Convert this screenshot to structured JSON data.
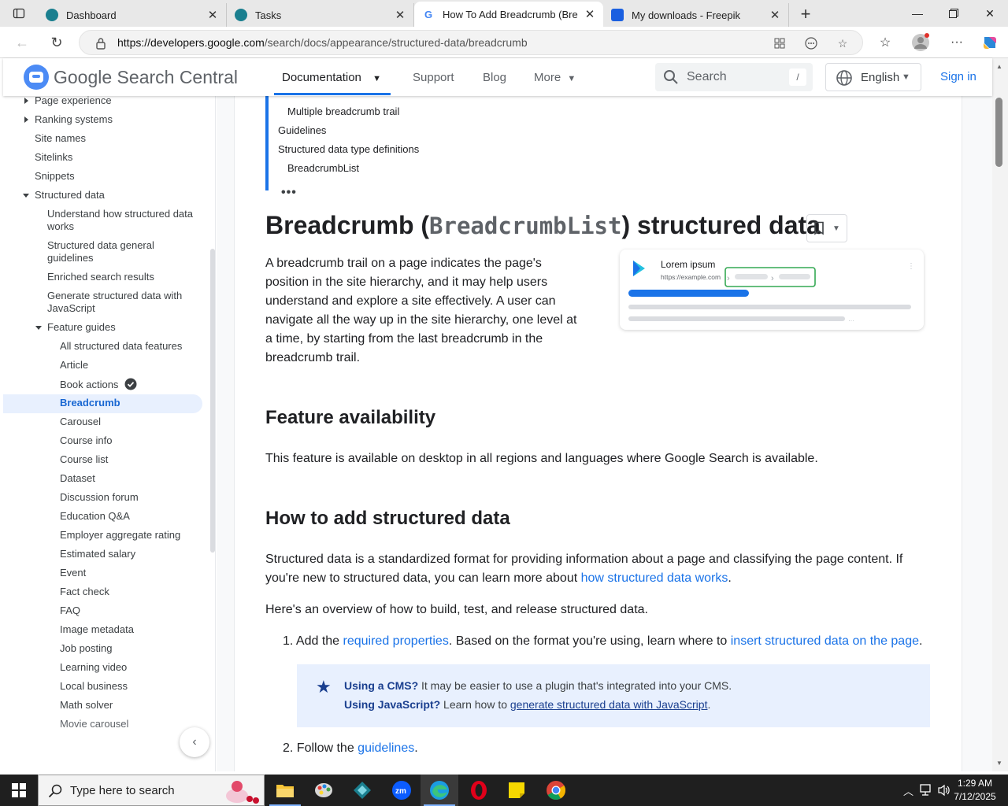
{
  "browser": {
    "tabs": [
      {
        "title": "Dashboard",
        "close": "✕",
        "favicon_color": "#1a7f8f"
      },
      {
        "title": "Tasks",
        "close": "✕",
        "favicon_color": "#1a7f8f"
      },
      {
        "title": "How To Add Breadcrumb (Breadc",
        "close": "✕",
        "favicon_color": "#4285f4"
      },
      {
        "title": "My downloads - Freepik",
        "close": "✕",
        "favicon_color": "#1a5fe0"
      }
    ],
    "url_domain": "https://developers.google.com",
    "url_path": "/search/docs/appearance/structured-data/breadcrumb"
  },
  "site": {
    "logo_google": "Google",
    "logo_product": " Search Central",
    "nav": {
      "documentation": "Documentation",
      "support": "Support",
      "blog": "Blog",
      "more": "More"
    },
    "search_placeholder": "Search",
    "search_shortcut": "/",
    "language": "English",
    "sign_in": "Sign in"
  },
  "leftnav": {
    "items": [
      {
        "label": "Page experience"
      },
      {
        "label": "Ranking systems"
      },
      {
        "label": "Site names"
      },
      {
        "label": "Sitelinks"
      },
      {
        "label": "Snippets"
      },
      {
        "label": "Structured data"
      },
      {
        "label": "Understand how structured data works"
      },
      {
        "label": "Structured data general guidelines"
      },
      {
        "label": "Enriched search results"
      },
      {
        "label": "Generate structured data with JavaScript"
      },
      {
        "label": "Feature guides"
      },
      {
        "label": "All structured data features"
      },
      {
        "label": "Article"
      },
      {
        "label": "Book actions"
      },
      {
        "label": "Breadcrumb"
      },
      {
        "label": "Carousel"
      },
      {
        "label": "Course info"
      },
      {
        "label": "Course list"
      },
      {
        "label": "Dataset"
      },
      {
        "label": "Discussion forum"
      },
      {
        "label": "Education Q&A"
      },
      {
        "label": "Employer aggregate rating"
      },
      {
        "label": "Estimated salary"
      },
      {
        "label": "Event"
      },
      {
        "label": "Fact check"
      },
      {
        "label": "FAQ"
      },
      {
        "label": "Image metadata"
      },
      {
        "label": "Job posting"
      },
      {
        "label": "Learning video"
      },
      {
        "label": "Local business"
      },
      {
        "label": "Math solver"
      },
      {
        "label": "Movie carousel"
      }
    ]
  },
  "toc": {
    "items": [
      "Multiple breadcrumb trail",
      "Guidelines",
      "Structured data type definitions",
      "BreadcrumbList"
    ],
    "more": "•••"
  },
  "article": {
    "title_pre": "Breadcrumb (",
    "title_code": "BreadcrumbList",
    "title_post": ") structured data",
    "intro": "A breadcrumb trail on a page indicates the page's position in the site hierarchy, and it may help users understand and explore a site effectively. A user can navigate all the way up in the site hierarchy, one level at a time, by starting from the last breadcrumb in the breadcrumb trail.",
    "illustration": {
      "title": "Lorem ipsum",
      "url": "https://example.com"
    },
    "h2_availability": "Feature availability",
    "availability_text": "This feature is available on desktop in all regions and languages where Google Search is available.",
    "h2_howto": "How to add structured data",
    "howto_p1_pre": "Structured data is a standardized format for providing information about a page and classifying the page content. If you're new to structured data, you can learn more about ",
    "howto_p1_link": "how structured data works",
    "howto_p1_post": ".",
    "howto_p2": "Here's an overview of how to build, test, and release structured data.",
    "step1_num": "1.",
    "step1_pre": "Add the ",
    "step1_link1": "required properties",
    "step1_mid": ". Based on the format you're using, learn where to ",
    "step1_link2": "insert structured data on the page",
    "step1_post": ".",
    "callout_l1_bold": "Using a CMS?",
    "callout_l1_text": " It may be easier to use a plugin that's integrated into your CMS.",
    "callout_l2_bold": "Using JavaScript?",
    "callout_l2_text": " Learn how to ",
    "callout_l2_link": "generate structured data with JavaScript",
    "callout_l2_post": ".",
    "step2_num": "2.",
    "step2_pre": "Follow the ",
    "step2_link": "guidelines",
    "step2_post": "."
  },
  "taskbar": {
    "search_placeholder": "Type here to search",
    "time": "1:29 AM",
    "date": "7/12/2025"
  }
}
